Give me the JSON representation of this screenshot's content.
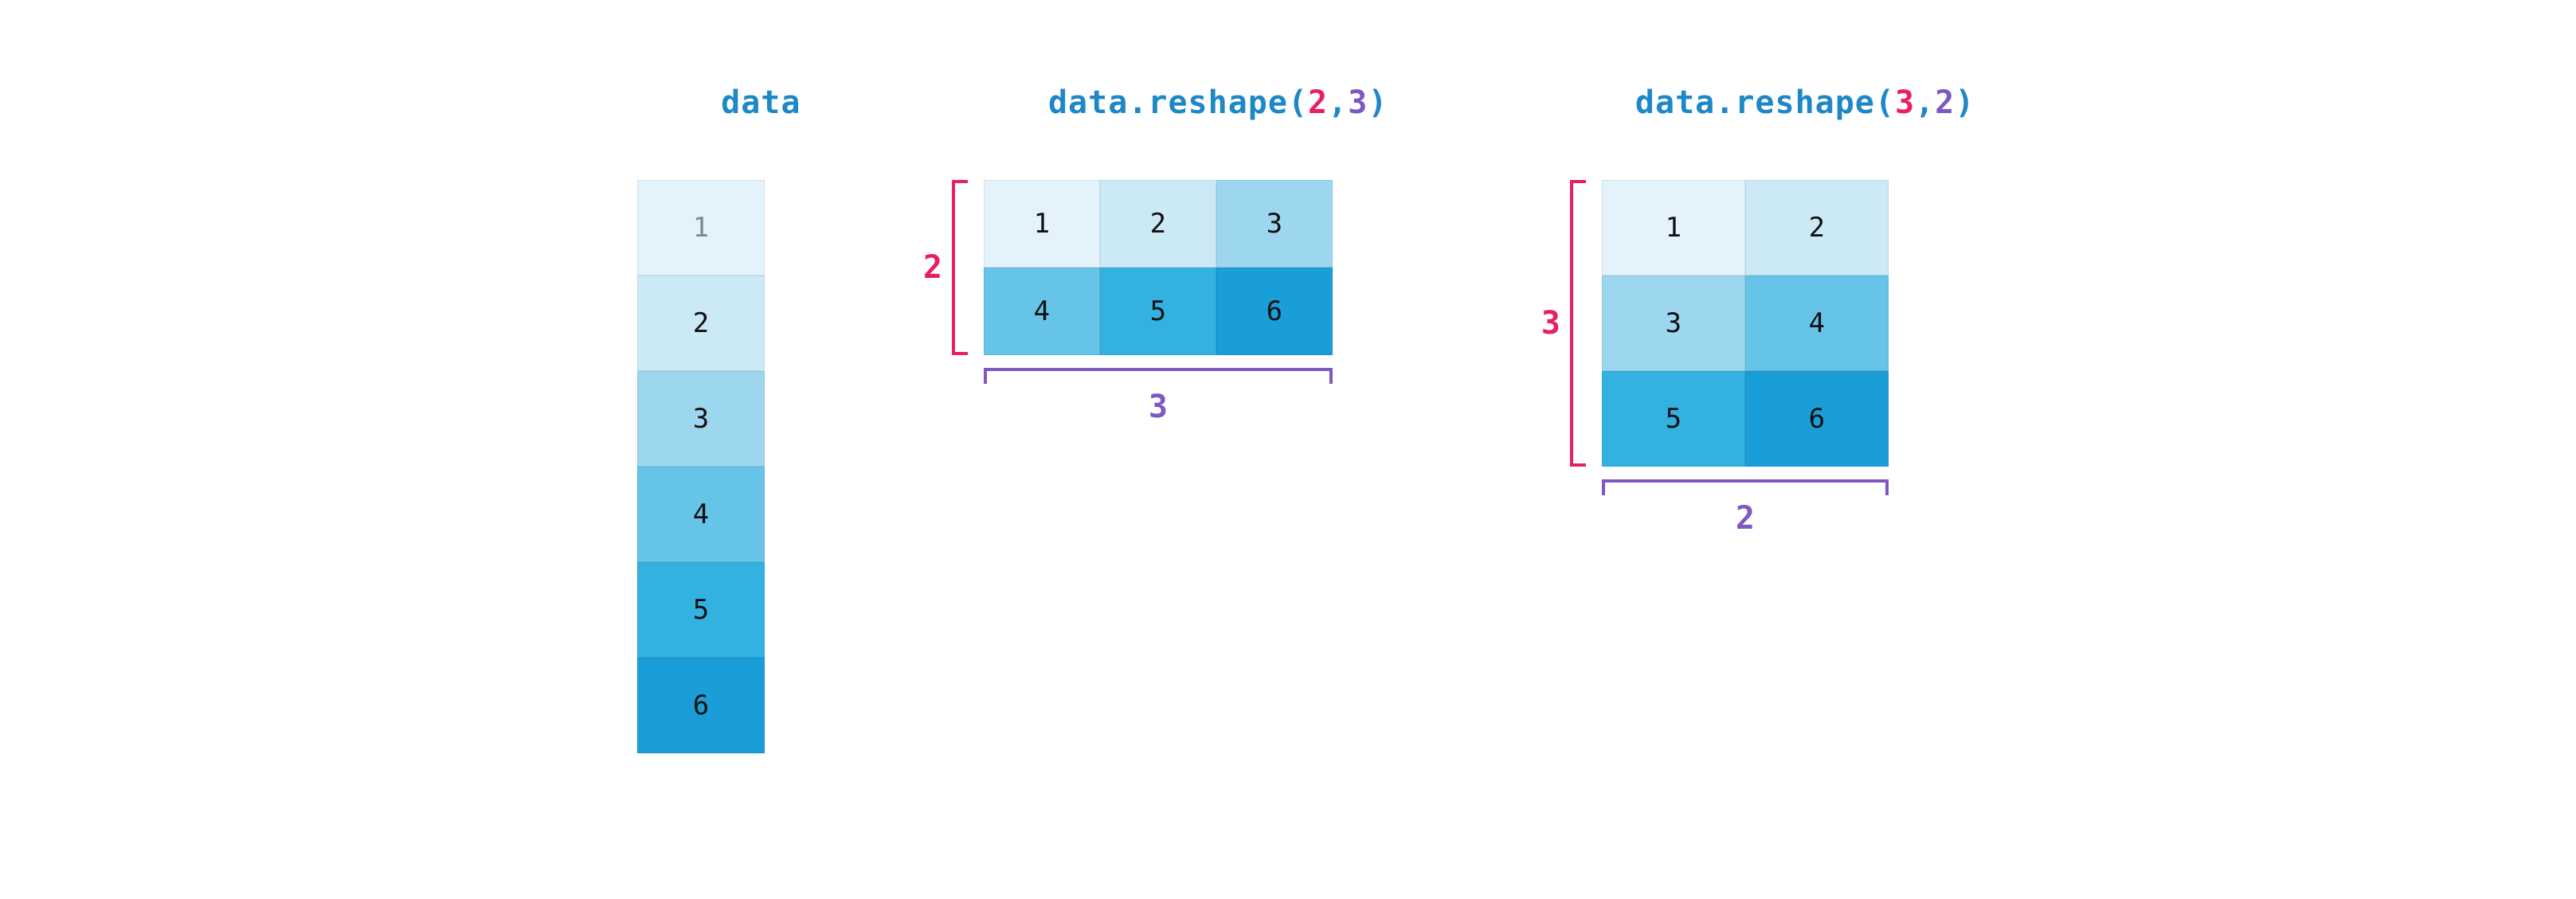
{
  "shades": [
    "#e3f2fb",
    "#cce9f6",
    "#9dd7ef",
    "#66c4e8",
    "#33b1e1",
    "#1a9ed8"
  ],
  "panels": {
    "data": {
      "label": "data",
      "cells": [
        1,
        2,
        3,
        4,
        5,
        6
      ]
    },
    "reshape23": {
      "label_parts": [
        "data.reshape(",
        "2",
        ",",
        "3",
        ")"
      ],
      "rows": 2,
      "cols": 3,
      "cells": [
        1,
        2,
        3,
        4,
        5,
        6
      ],
      "row_dim_label": "2",
      "col_dim_label": "3"
    },
    "reshape32": {
      "label_parts": [
        "data.reshape(",
        "3",
        ",",
        "2",
        ")"
      ],
      "rows": 3,
      "cols": 2,
      "cells": [
        1,
        2,
        3,
        4,
        5,
        6
      ],
      "row_dim_label": "3",
      "col_dim_label": "2"
    }
  },
  "chart_data": {
    "type": "table",
    "title": "numpy array reshape illustration",
    "source_array": [
      1,
      2,
      3,
      4,
      5,
      6
    ],
    "reshapes": [
      {
        "call": "data.reshape(2,3)",
        "shape": [
          2,
          3
        ],
        "result": [
          [
            1,
            2,
            3
          ],
          [
            4,
            5,
            6
          ]
        ]
      },
      {
        "call": "data.reshape(3,2)",
        "shape": [
          3,
          2
        ],
        "result": [
          [
            1,
            2
          ],
          [
            3,
            4
          ],
          [
            5,
            6
          ]
        ]
      }
    ]
  }
}
